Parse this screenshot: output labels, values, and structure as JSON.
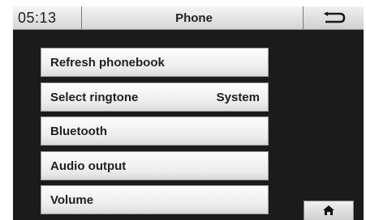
{
  "status_bar": {
    "time": "05:13",
    "title": "Phone"
  },
  "menu": {
    "items": [
      {
        "label": "Refresh phonebook",
        "value": ""
      },
      {
        "label": "Select ringtone",
        "value": "System"
      },
      {
        "label": "Bluetooth",
        "value": ""
      },
      {
        "label": "Audio output",
        "value": ""
      },
      {
        "label": "Volume",
        "value": ""
      }
    ]
  },
  "icons": {
    "back": "back-arrow-icon",
    "home": "home-icon"
  }
}
